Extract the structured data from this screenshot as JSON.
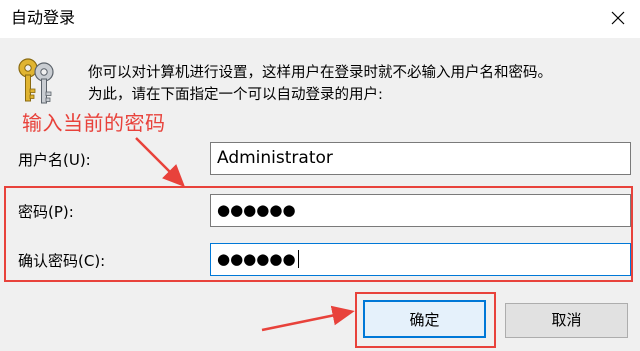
{
  "window": {
    "title": "自动登录",
    "close_glyph": "✕"
  },
  "description": {
    "line1": "你可以对计算机进行设置，这样用户在登录时就不必输入用户名和密码。",
    "line2": "为此，请在下面指定一个可以自动登录的用户:"
  },
  "annotation": {
    "text": "输入当前的密码",
    "color": "#e8423b"
  },
  "form": {
    "username_label": "用户名(U):",
    "username_value": "Administrator",
    "password_label": "密码(P):",
    "password_value": "●●●●●●",
    "confirm_label": "确认密码(C):",
    "confirm_value": "●●●●●●"
  },
  "buttons": {
    "ok_label": "确定",
    "cancel_label": "取消"
  },
  "colors": {
    "accent": "#0078d7",
    "highlight": "#e8423b",
    "background": "#f0f0f0"
  },
  "icons": {
    "close": "close-icon",
    "keys": "keys-icon"
  }
}
